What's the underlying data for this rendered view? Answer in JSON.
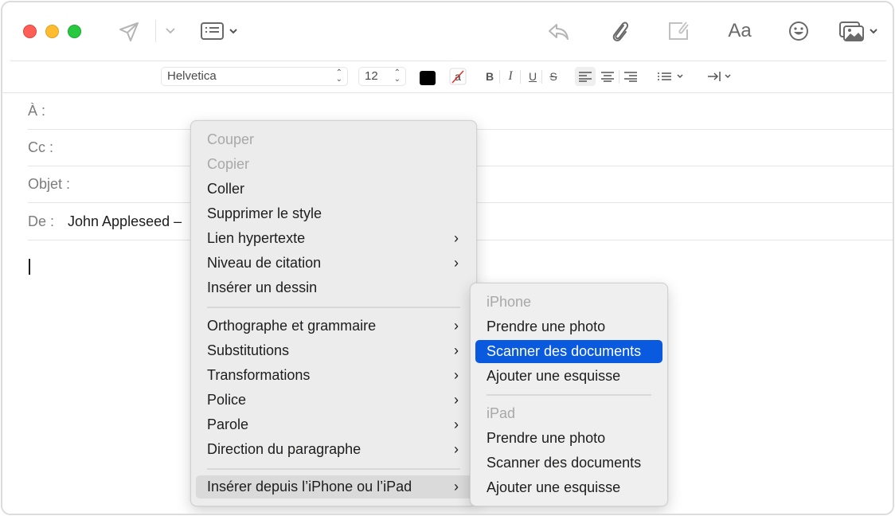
{
  "window": {
    "traffic_lights": {
      "close": "close",
      "minimize": "minimize",
      "zoom": "zoom"
    }
  },
  "toolbar": {
    "send_icon": "paper-plane-icon",
    "header_fields_icon": "header-fields-icon",
    "reply_icon": "reply-icon",
    "attach_icon": "paperclip-icon",
    "annotate_icon": "annotate-attachment-icon",
    "format_label": "Aa",
    "emoji_icon": "smiley-icon",
    "photo_browser_icon": "photo-browser-icon"
  },
  "format_bar": {
    "font": "Helvetica",
    "font_size": "12",
    "text_color": "#000000",
    "bold": "B",
    "italic": "I",
    "underline": "U",
    "strikethrough": "S",
    "background_color_glyph": "a"
  },
  "header": {
    "to_label": "À :",
    "cc_label": "Cc :",
    "subject_label": "Objet :",
    "from_label": "De :",
    "from_value": "John Appleseed –"
  },
  "context_menu": {
    "items": [
      {
        "label": "Couper",
        "disabled": true
      },
      {
        "label": "Copier",
        "disabled": true
      },
      {
        "label": "Coller"
      },
      {
        "label": "Supprimer le style"
      },
      {
        "label": "Lien hypertexte",
        "submenu": true
      },
      {
        "label": "Niveau de citation",
        "submenu": true
      },
      {
        "label": "Insérer un dessin"
      },
      {
        "label": "Orthographe et grammaire",
        "submenu": true
      },
      {
        "label": "Substitutions",
        "submenu": true
      },
      {
        "label": "Transformations",
        "submenu": true
      },
      {
        "label": "Police",
        "submenu": true
      },
      {
        "label": "Parole",
        "submenu": true
      },
      {
        "label": "Direction du paragraphe",
        "submenu": true
      },
      {
        "label": "Insérer depuis l’iPhone ou l’iPad",
        "submenu": true,
        "highlighted": true
      }
    ],
    "chevron": "›"
  },
  "submenu": {
    "iphone_header": "iPhone",
    "iphone_items": [
      "Prendre une photo",
      "Scanner des documents",
      "Ajouter une esquisse"
    ],
    "ipad_header": "iPad",
    "ipad_items": [
      "Prendre une photo",
      "Scanner des documents",
      "Ajouter une esquisse"
    ],
    "selected": "Scanner des documents",
    "selected_color": "#0a5ae0"
  }
}
